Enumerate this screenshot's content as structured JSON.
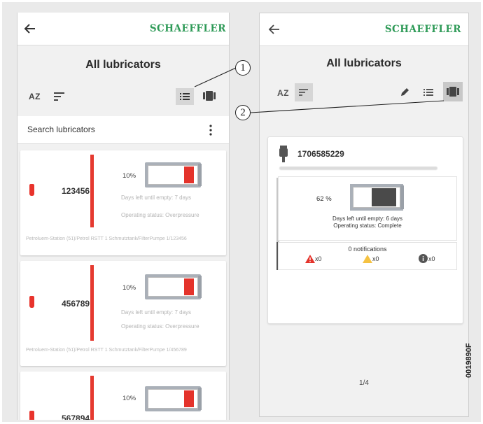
{
  "brand": "SCHAEFFLER",
  "left_screen": {
    "title": "All lubricators",
    "toolbar": {
      "sort_az_label": "AZ"
    },
    "search": {
      "placeholder": "Search lubricators"
    },
    "cards": [
      {
        "id": "123456",
        "percent": "10%",
        "fill_fraction": 0.1,
        "days_left": "Days left until empty: 7 days",
        "status": "Operating status: Overpressure",
        "path": "Petroluem-Station (51)/Petrol RSTT 1 Schmutztank/FilterPumpe 1/123456"
      },
      {
        "id": "456789",
        "percent": "10%",
        "fill_fraction": 0.1,
        "days_left": "Days left until empty: 7 days",
        "status": "Operating status: Overpressure",
        "path": "Petroluem-Station (51)/Petrol RSTT 1 Schmutztank/FilterPumpe 1/456789"
      },
      {
        "id": "567894",
        "percent": "10%",
        "fill_fraction": 0.1
      }
    ]
  },
  "right_screen": {
    "title": "All lubricators",
    "toolbar": {
      "sort_az_label": "AZ"
    },
    "detail": {
      "id": "1706585229",
      "percent": "62 %",
      "fill_fraction": 0.62,
      "days_left": "Days left until empty: 6 days",
      "status": "Operating status: Complete",
      "notifications_title": "0 notifications",
      "alarm_count": "x0",
      "warning_count": "x0",
      "info_count": "x0"
    },
    "pagination": "1/4"
  },
  "callouts": [
    "1",
    "2"
  ],
  "figure_code": "0019890F",
  "colors": {
    "brand_green": "#2e9a57",
    "alarm_red": "#e4332b",
    "warning_yellow": "#f5c242",
    "gauge_dark": "#4a4a4a",
    "background": "#eaeaea"
  }
}
